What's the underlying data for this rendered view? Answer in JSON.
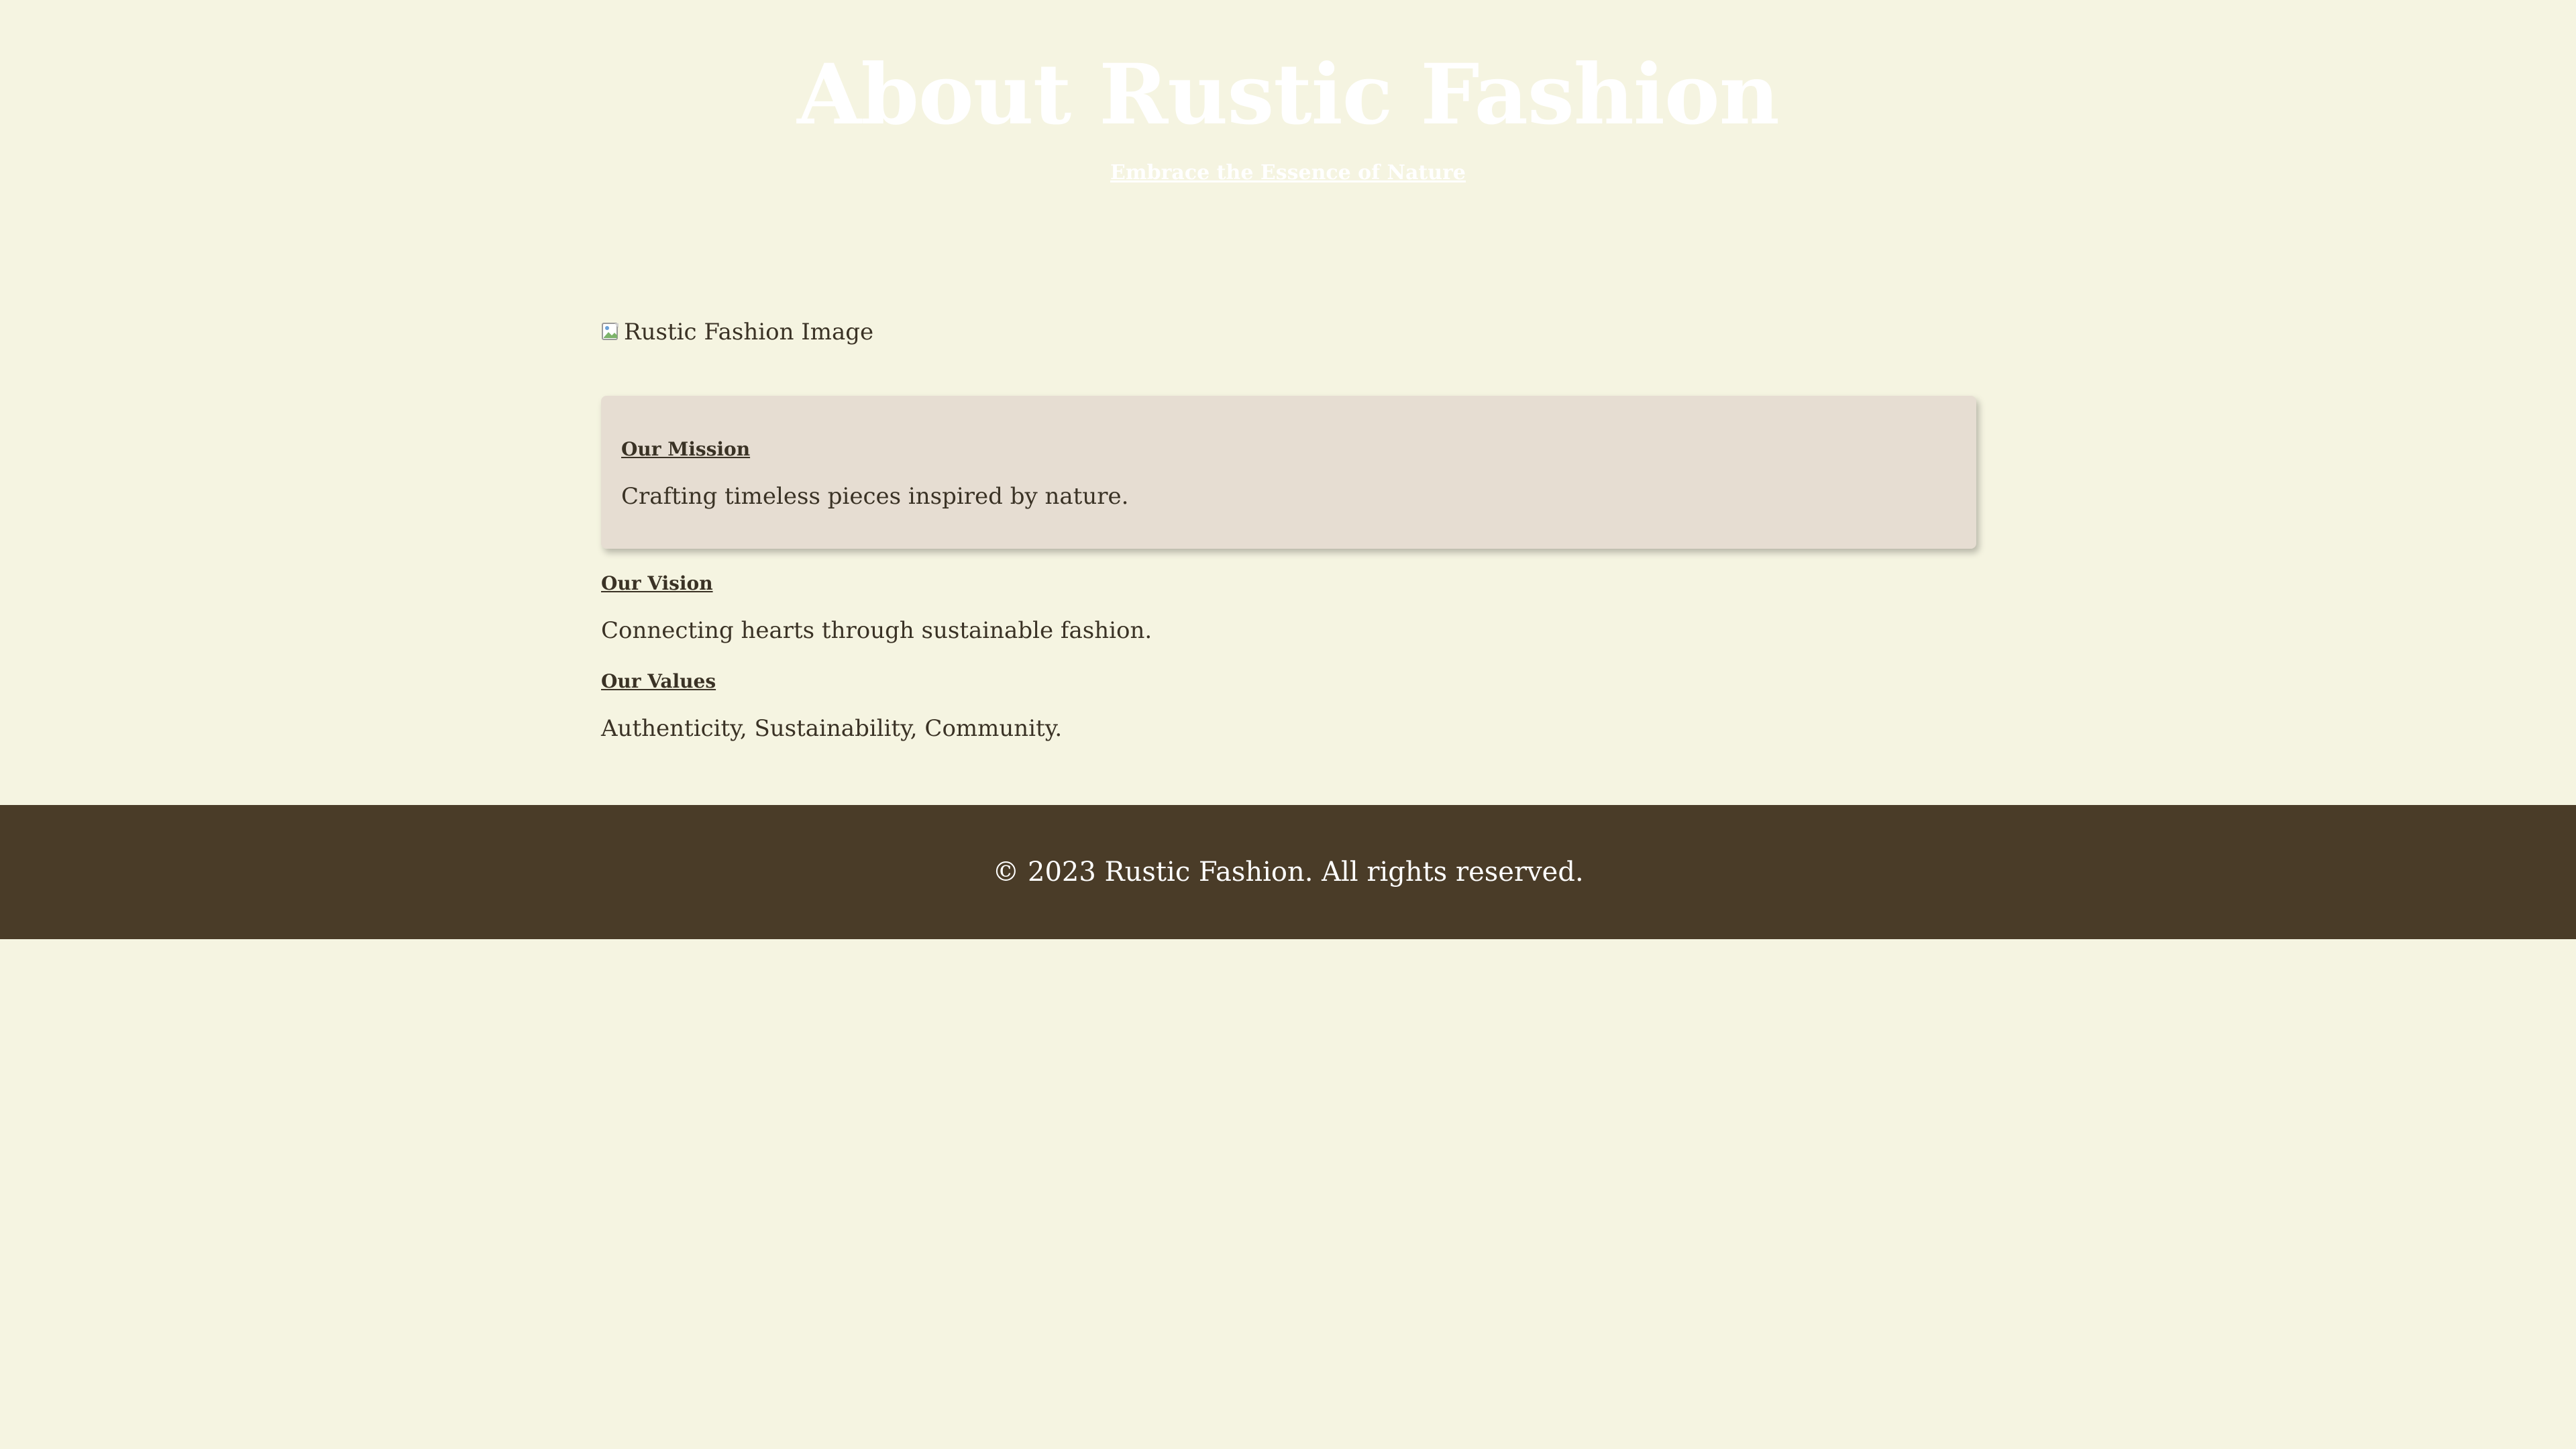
{
  "header": {
    "title": "About Rustic Fashion",
    "tagline": "Embrace the Essence of Nature"
  },
  "main": {
    "image_alt": "Rustic Fashion Image",
    "mission": {
      "heading": "Our Mission",
      "text": "Crafting timeless pieces inspired by nature."
    },
    "vision": {
      "heading": "Our Vision",
      "text": "Connecting hearts through sustainable fashion."
    },
    "values": {
      "heading": "Our Values",
      "text": "Authenticity, Sustainability, Community."
    }
  },
  "footer": {
    "copyright": "© 2023 Rustic Fashion. All rights reserved."
  },
  "colors": {
    "background": "#f5f4e1",
    "card": "#e6ddd2",
    "footer": "#4a3c28",
    "text": "#3a3225",
    "heading_on_light": "#ffffff"
  },
  "icons": {
    "image_placeholder": "broken-image-icon"
  }
}
